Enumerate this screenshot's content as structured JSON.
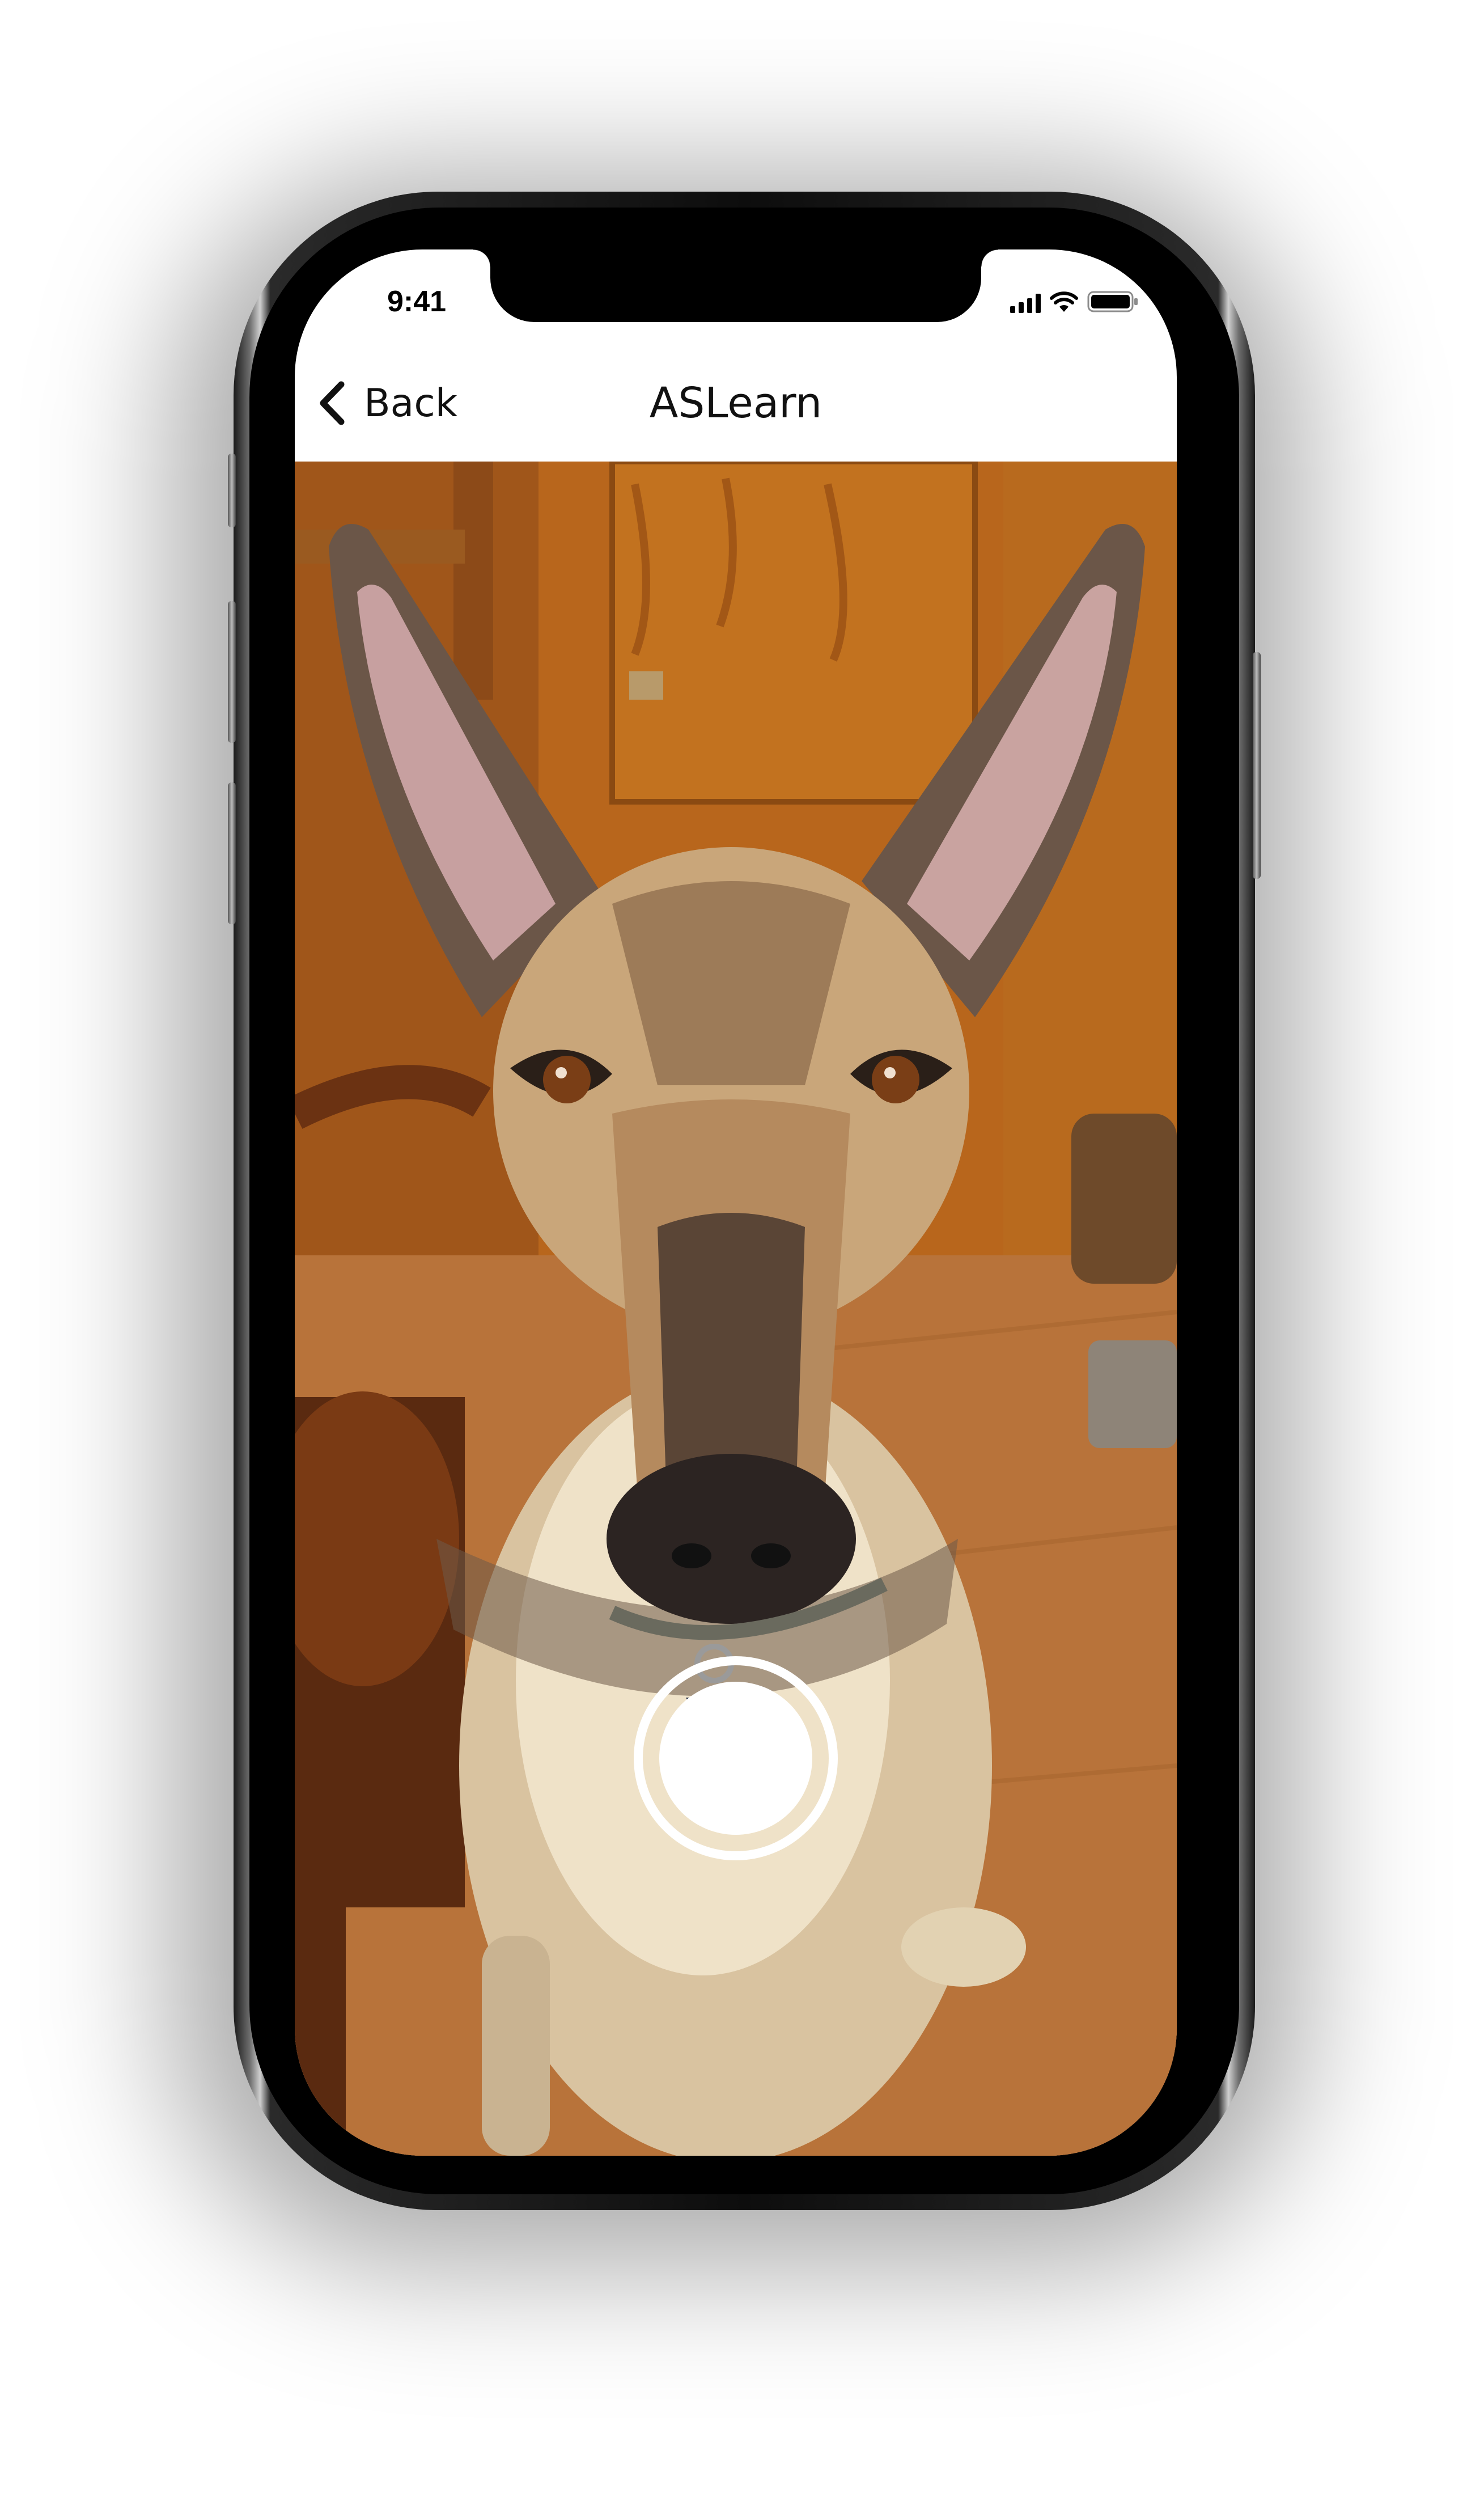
{
  "status_bar": {
    "time": "9:41",
    "icons": [
      "cellular-signal-icon",
      "wifi-icon",
      "battery-icon"
    ]
  },
  "nav_bar": {
    "back_label": "Back",
    "back_icon": "chevron-left-icon",
    "title": "ASLearn"
  },
  "camera_view": {
    "content": "live camera preview",
    "shutter_icon": "shutter-button-icon"
  },
  "colors": {
    "nav_background": "#ffffff",
    "text": "#111111",
    "shutter": "#ffffff"
  }
}
